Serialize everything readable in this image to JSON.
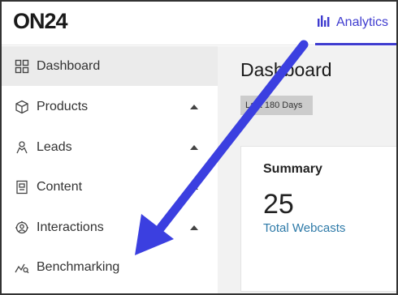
{
  "header": {
    "logo": "ON24",
    "analytics_tab": {
      "label": "Analytics",
      "icon": "bar-chart-icon",
      "color": "#3f3ccf"
    }
  },
  "sidebar": {
    "items": [
      {
        "label": "Dashboard",
        "icon": "grid-icon",
        "active": true
      },
      {
        "label": "Products",
        "icon": "cube-icon",
        "expandable": true
      },
      {
        "label": "Leads",
        "icon": "person-icon",
        "expandable": true
      },
      {
        "label": "Content",
        "icon": "document-icon",
        "expandable": true
      },
      {
        "label": "Interactions",
        "icon": "interactions-icon",
        "expandable": true
      },
      {
        "label": "Benchmarking",
        "icon": "benchmark-icon",
        "expandable": false
      }
    ]
  },
  "main": {
    "title": "Dashboard",
    "date_range": "Last 180 Days",
    "summary": {
      "title": "Summary",
      "value": "25",
      "label": "Total Webcasts",
      "label_color": "#2e7aa8"
    }
  },
  "annotation": {
    "icon": "pointer-arrow-icon",
    "color": "#3b3fe0"
  }
}
